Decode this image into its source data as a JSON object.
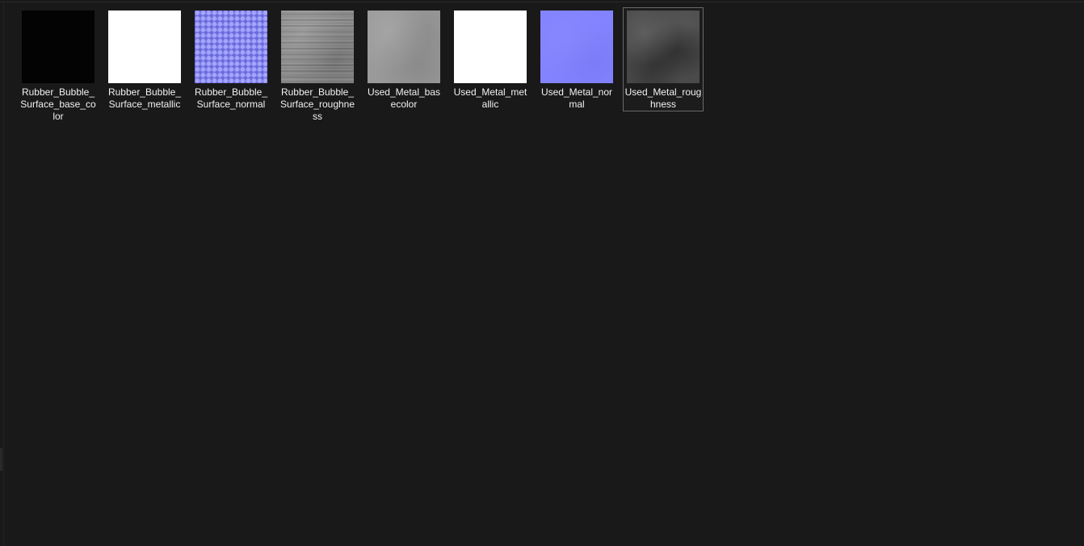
{
  "files": [
    {
      "name": "Rubber_Bubble_Surface_base_color",
      "thumbnail": "black",
      "selected": false
    },
    {
      "name": "Rubber_Bubble_Surface_metallic",
      "thumbnail": "white",
      "selected": false
    },
    {
      "name": "Rubber_Bubble_Surface_normal",
      "thumbnail": "normal-map-bubbles",
      "selected": false
    },
    {
      "name": "Rubber_Bubble_Surface_roughness",
      "thumbnail": "gray-roughness-streaks",
      "selected": false
    },
    {
      "name": "Used_Metal_basecolor",
      "thumbnail": "light-gray-metal",
      "selected": false
    },
    {
      "name": "Used_Metal_metallic",
      "thumbnail": "white",
      "selected": false
    },
    {
      "name": "Used_Metal_normal",
      "thumbnail": "normal-map-flat",
      "selected": false
    },
    {
      "name": "Used_Metal_roughness",
      "thumbnail": "dark-gray-cloudy",
      "selected": true
    }
  ],
  "colors": {
    "background": "#191919",
    "label_text": "#f2f2f2",
    "selection_border": "#6a6a6a"
  }
}
